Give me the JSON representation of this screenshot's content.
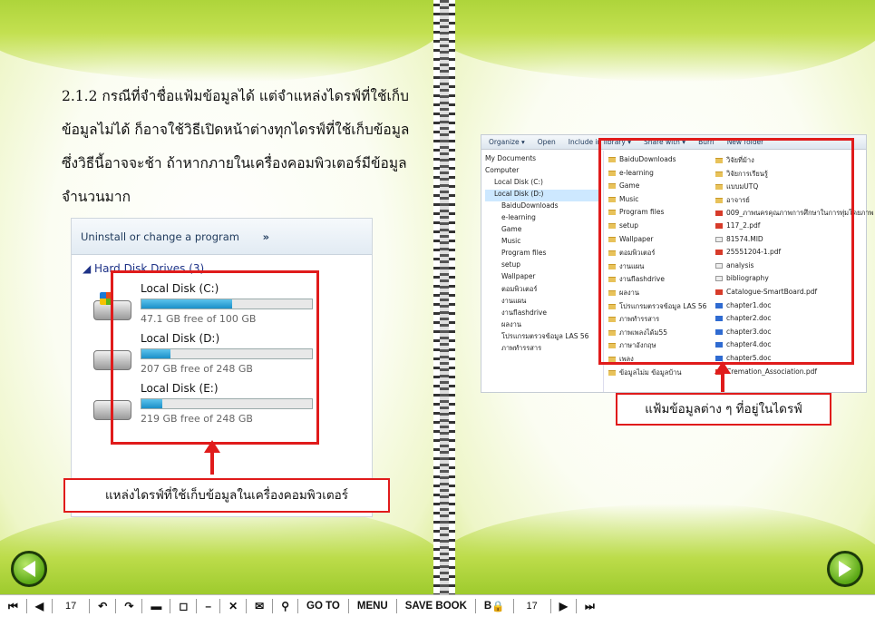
{
  "left_page": {
    "paragraph": "2.1.2 กรณีที่จำชื่อแฟ้มข้อมูลได้ แต่จำแหล่งไดรฟ์ที่ใช้เก็บข้อมูลไม่ได้ ก็อาจใช้วิธีเปิดหน้าต่างทุกไดรฟ์ที่ใช้เก็บข้อมูล ซึ่งวิธีนี้อาจจะช้า ถ้าหากภายในเครื่องคอมพิวเตอร์มีข้อมูลจำนวนมาก",
    "screenshot": {
      "bar_label": "Uninstall or change a program",
      "bar_more": "»",
      "section": "◢ Hard Disk Drives (3)",
      "drives": [
        {
          "name": "Local Disk (C:)",
          "free": "47.1 GB free of 100 GB",
          "used_fraction": 0.53
        },
        {
          "name": "Local Disk (D:)",
          "free": "207 GB free of 248 GB",
          "used_fraction": 0.17
        },
        {
          "name": "Local Disk (E:)",
          "free": "219 GB free of 248 GB",
          "used_fraction": 0.12
        }
      ]
    },
    "caption": "แหล่งไดรฟ์ที่ใช้เก็บข้อมูลในเครื่องคอมพิวเตอร์"
  },
  "right_page": {
    "toolbar": [
      "Organize ▾",
      "Open",
      "Include in library ▾",
      "Share with ▾",
      "Burn",
      "New folder"
    ],
    "nav": [
      "My Documents",
      "Computer",
      "Local Disk (C:)",
      "Local Disk (D:)",
      "BaiduDownloads",
      "e-learning",
      "Game",
      "Music",
      "Program files",
      "setup",
      "Wallpaper",
      "ตอมพิวเตอร์",
      "งานแผน",
      "งานflashdrive",
      "ผลงาน",
      "โปรแกรมตรวจข้อมูล LAS 56",
      "ภาพทำรรสาร"
    ],
    "col1": [
      {
        "name": "BaiduDownloads",
        "type": "folder"
      },
      {
        "name": "e-learning",
        "type": "folder"
      },
      {
        "name": "Game",
        "type": "folder"
      },
      {
        "name": "Music",
        "type": "folder"
      },
      {
        "name": "Program files",
        "type": "folder"
      },
      {
        "name": "setup",
        "type": "folder"
      },
      {
        "name": "Wallpaper",
        "type": "folder"
      },
      {
        "name": "ตอมพิวเตอร์",
        "type": "folder"
      },
      {
        "name": "งานแผน",
        "type": "folder"
      },
      {
        "name": "งานflashdrive",
        "type": "folder"
      },
      {
        "name": "ผลงาน",
        "type": "folder"
      },
      {
        "name": "โปรแกรมตรวจข้อมูล LAS 56",
        "type": "folder"
      },
      {
        "name": "ภาพทำรรสาร",
        "type": "folder"
      },
      {
        "name": "ภาพเพลงได้ม55",
        "type": "folder"
      },
      {
        "name": "ภาษาอังกฤษ",
        "type": "folder"
      },
      {
        "name": "เพลง",
        "type": "folder"
      },
      {
        "name": "ข้อมูลไม่ม ข้อมูลบ้าน",
        "type": "folder"
      }
    ],
    "col2": [
      {
        "name": "วิจัยที่ม้าง",
        "type": "folder"
      },
      {
        "name": "วิจัยการเรียนรู้",
        "type": "folder"
      },
      {
        "name": "แบบมUTQ",
        "type": "folder"
      },
      {
        "name": "อาจารย์",
        "type": "folder"
      },
      {
        "name": "009_ภาพนครคุณภาพการศึกษาในการทุ่มโดยภาพ",
        "type": "pdf"
      },
      {
        "name": "117_2.pdf",
        "type": "pdf"
      },
      {
        "name": "81574.MID",
        "type": "file"
      },
      {
        "name": "25551204-1.pdf",
        "type": "pdf"
      },
      {
        "name": "analysis",
        "type": "file"
      },
      {
        "name": "bibliography",
        "type": "file"
      },
      {
        "name": "Catalogue-SmartBoard.pdf",
        "type": "pdf"
      },
      {
        "name": "chapter1.doc",
        "type": "doc"
      },
      {
        "name": "chapter2.doc",
        "type": "doc"
      },
      {
        "name": "chapter3.doc",
        "type": "doc"
      },
      {
        "name": "chapter4.doc",
        "type": "doc"
      },
      {
        "name": "chapter5.doc",
        "type": "doc"
      },
      {
        "name": "Cremation_Association.pdf",
        "type": "pdf"
      }
    ],
    "caption": "แฟ้มข้อมูลต่าง ๆ ที่อยู่ในไดรฟ์"
  },
  "bottom_bar": {
    "page_left": "17",
    "page_right": "17",
    "goto": "GO TO",
    "menu": "MENU",
    "save": "SAVE BOOK",
    "b": "B"
  }
}
